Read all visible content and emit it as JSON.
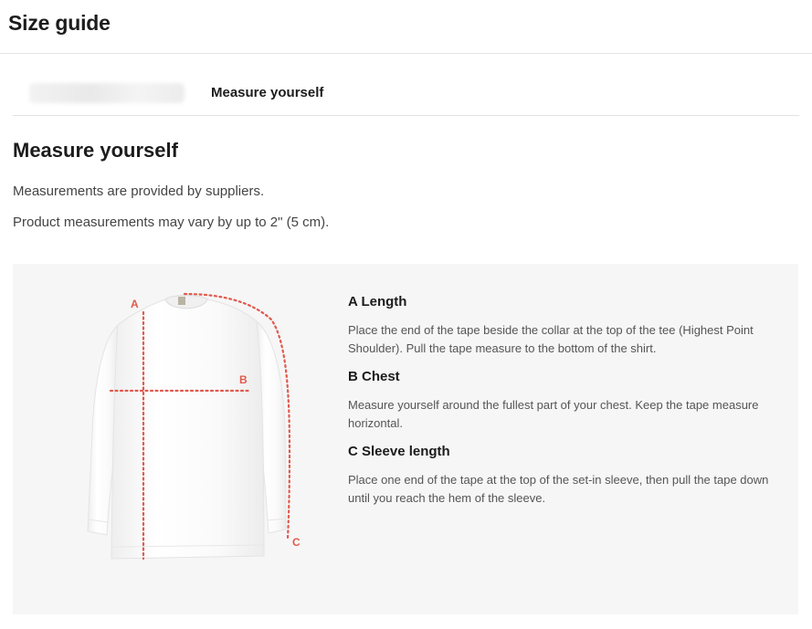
{
  "header": {
    "title": "Size guide"
  },
  "tabs": {
    "active_label": "Measure yourself"
  },
  "main": {
    "title": "Measure yourself",
    "notes": [
      "Measurements are provided by suppliers.",
      "Product measurements may vary by up to 2\" (5 cm)."
    ]
  },
  "illustration": {
    "labels": {
      "a": "A",
      "b": "B",
      "c": "C"
    },
    "marker_color": "#e05a4e",
    "shirt_color": "#ffffff"
  },
  "measurements": [
    {
      "title": "A Length",
      "description": "Place the end of the tape beside the collar at the top of the tee (Highest Point Shoulder). Pull the tape measure to the bottom of the shirt."
    },
    {
      "title": "B Chest",
      "description": "Measure yourself around the fullest part of your chest. Keep the tape measure horizontal."
    },
    {
      "title": "C Sleeve length",
      "description": "Place one end of the tape at the top of the set-in sleeve, then pull the tape down until you reach the hem of the sleeve."
    }
  ]
}
